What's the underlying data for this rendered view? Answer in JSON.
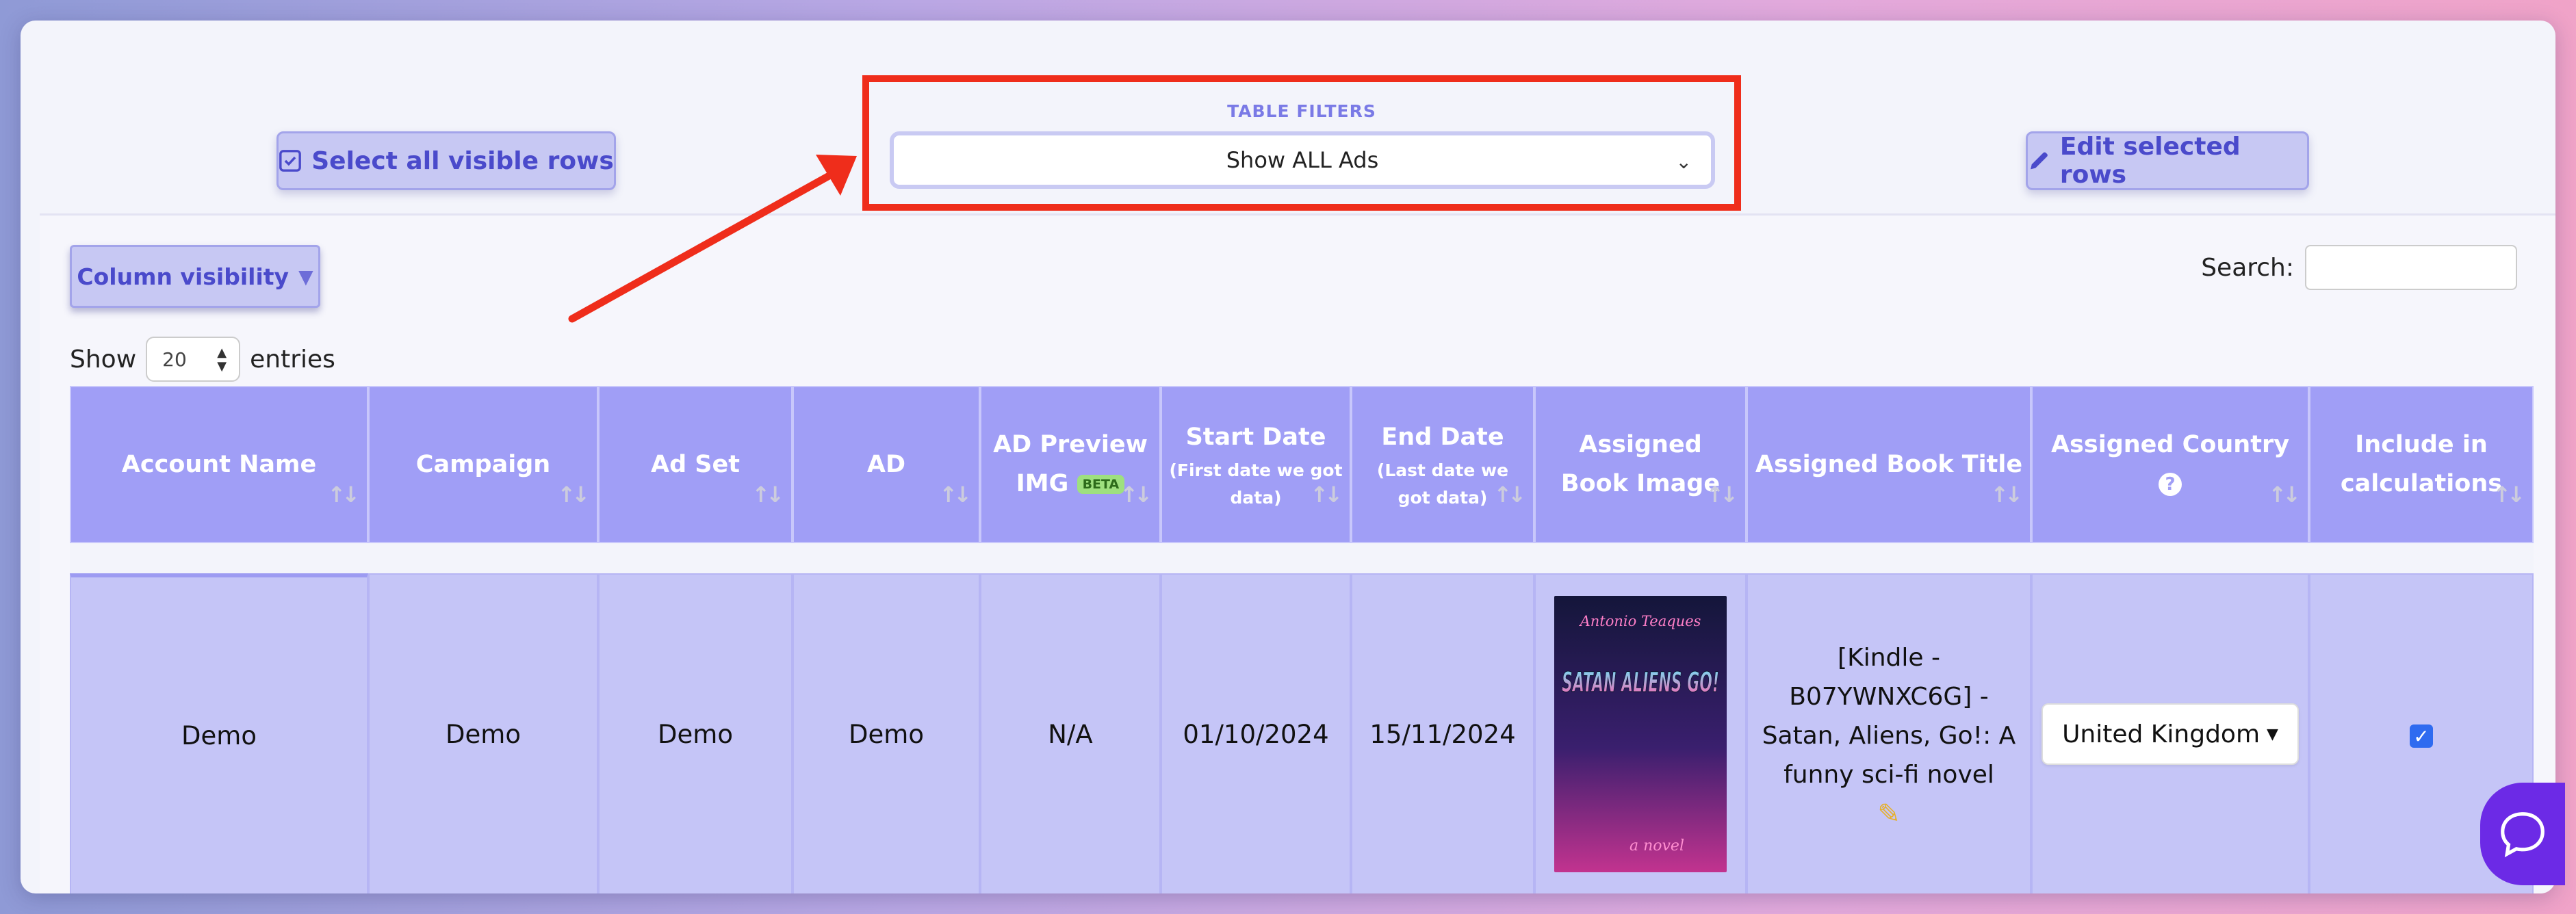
{
  "toolbar": {
    "select_all_label": "Select all visible rows",
    "edit_selected_label": "Edit selected rows"
  },
  "filters": {
    "label": "TABLE FILTERS",
    "selected": "Show ALL Ads"
  },
  "table_controls": {
    "column_visibility_label": "Column visibility",
    "show_label": "Show",
    "page_length": "20",
    "entries_label": "entries",
    "search_label": "Search:"
  },
  "columns": [
    {
      "label": "Account Name"
    },
    {
      "label": "Campaign"
    },
    {
      "label": "Ad Set"
    },
    {
      "label": "AD"
    },
    {
      "label": "AD Preview IMG",
      "badge": "BETA"
    },
    {
      "label": "Start Date",
      "note": "(First date we got data)"
    },
    {
      "label": "End Date",
      "note": "(Last date we got data)"
    },
    {
      "label": "Assigned Book Image"
    },
    {
      "label": "Assigned Book Title"
    },
    {
      "label": "Assigned Country"
    },
    {
      "label": "Include in calculations"
    }
  ],
  "rows": [
    {
      "account_name": "Demo",
      "campaign": "Demo",
      "ad_set": "Demo",
      "ad": "Demo",
      "ad_preview": "N/A",
      "start_date": "01/10/2024",
      "end_date": "15/11/2024",
      "book_author": "Antonio Teaques",
      "book_cover_title": "SATAN ALIENS GO!",
      "book_cover_subtitle": "a novel",
      "book_title": "[Kindle - B07YWNXC6G] - Satan, Aliens, Go!: A funny sci-fi novel",
      "country": "United Kingdom",
      "include": true
    }
  ],
  "icons": {
    "select_all": "checkbox-icon",
    "edit": "pencil-icon",
    "chat": "chat-bubble-icon"
  },
  "colors": {
    "header_bg": "#a09ef6",
    "row_bg": "#c5c5f7",
    "annotation_red": "#ef2d1b",
    "chat_purple": "#6c2ae6"
  }
}
